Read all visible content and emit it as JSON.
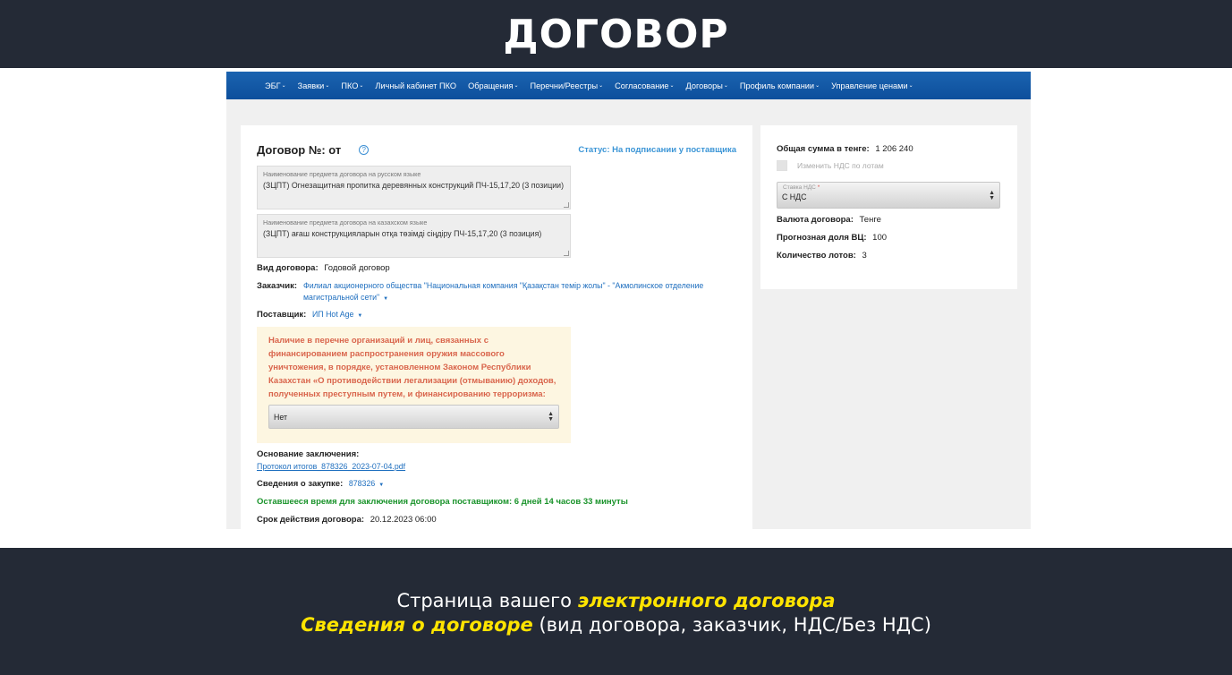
{
  "banner": {
    "title": "ДОГОВОР"
  },
  "navbar": {
    "items": [
      {
        "label": "ЭБГ",
        "dropdown": true
      },
      {
        "label": "Заявки",
        "dropdown": true
      },
      {
        "label": "ПКО",
        "dropdown": true
      },
      {
        "label": "Личный кабинет ПКО",
        "dropdown": false
      },
      {
        "label": "Обращения",
        "dropdown": true
      },
      {
        "label": "Перечни/Реестры",
        "dropdown": true
      },
      {
        "label": "Согласование",
        "dropdown": true
      },
      {
        "label": "Договоры",
        "dropdown": true
      },
      {
        "label": "Профиль компании",
        "dropdown": true
      },
      {
        "label": "Управление ценами",
        "dropdown": true
      }
    ]
  },
  "contract": {
    "title": "Договор №:  от",
    "help_icon": "?",
    "status": "Статус: На подписании у поставщика",
    "subject_ru": {
      "label": "Наименование предмета договора на русском языке",
      "value": "(ЗЦПТ) Огнезащитная пропитка деревянных конструкций ПЧ-15,17,20 (3 позиции)"
    },
    "subject_kz": {
      "label": "Наименование предмета договора на казахском языке",
      "value": "(ЗЦПТ) ағаш конструкцияларын отқа төзімді сіңдіру  ПЧ-15,17,20 (3 позиция)"
    },
    "type_label": "Вид договора:",
    "type_value": "Годовой договор",
    "customer_label": "Заказчик:",
    "customer_value_1": "Филиал акционерного общества \"Национальная компания \"Қазақстан темір жолы\" - \"Акмолинское отделение",
    "customer_value_2": "магистральной сети\"",
    "supplier_label": "Поставщик:",
    "supplier_value": "ИП Hot Age",
    "warning": {
      "text": "Наличие в перечне организаций и лиц, связанных с финансированием распространения оружия массового уничтожения, в порядке, установленном Законом Республики Казахстан «О противодействии легализации (отмыванию) доходов, полученных преступным путем, и финансированию терроризма:",
      "select_value": "Нет"
    },
    "basis_label": "Основание заключения:",
    "basis_file": "Протокол итогов_878326_2023-07-04.pdf",
    "purchase_label": "Сведения о закупке:",
    "purchase_value": "878326",
    "remaining_time": "Оставшееся время для заключения договора поставщиком: 6 дней 14 часов 33 минуты",
    "validity_label": "Срок действия договора:",
    "validity_value": "20.12.2023 06:00"
  },
  "summary": {
    "total_label": "Общая сумма в тенге:",
    "total_value": "1 206 240",
    "vat_checkbox_label": "Изменить НДС по лотам",
    "vat_select_caption": "Ставка НДС",
    "vat_select_required": "*",
    "vat_select_value": "С НДС",
    "currency_label": "Валюта договора:",
    "currency_value": "Тенге",
    "share_label": "Прогнозная доля ВЦ:",
    "share_value": "100",
    "lots_label": "Количество лотов:",
    "lots_value": "3"
  },
  "caption": {
    "line1_prefix": "Страница вашего ",
    "line1_highlight": "электронного договора",
    "line2_highlight": "Сведения о договоре",
    "line2_suffix": " (вид договора, заказчик, НДС/Без НДС)"
  },
  "colors": {
    "banner_bg": "#242a36",
    "navbar_bg": "#0d4f9c",
    "status_blue": "#3b95d6",
    "warning_red": "#d9654c",
    "warning_bg": "#fdf6e1",
    "timer_green": "#19932a",
    "caption_highlight": "#ffe400"
  }
}
